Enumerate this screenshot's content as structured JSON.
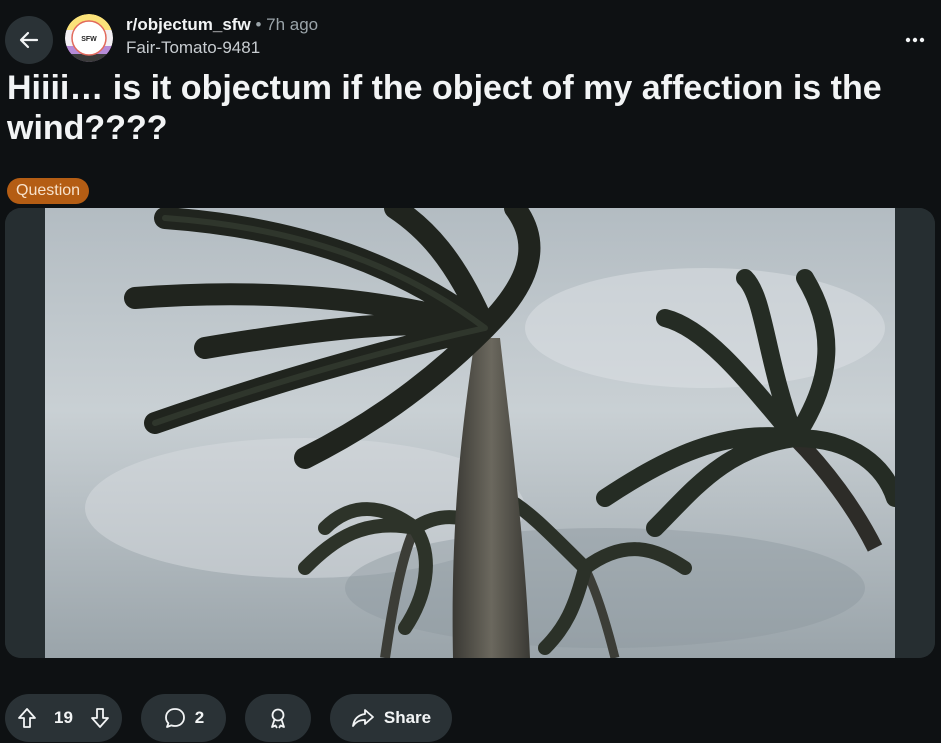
{
  "post": {
    "subreddit": "r/objectum_sfw",
    "separator": "•",
    "time_ago": "7h ago",
    "author": "Fair-Tomato-9481",
    "avatar_text": "SFW",
    "title": "Hiiii… is it objectum if the object of my affection is the wind????",
    "flair": "Question"
  },
  "actions": {
    "vote_count": "19",
    "comment_count": "2",
    "share_label": "Share"
  },
  "icons": {
    "back": "arrow-left-icon",
    "more": "more-horizontal-icon",
    "upvote": "arrow-up-icon",
    "downvote": "arrow-down-icon",
    "comment": "speech-bubble-icon",
    "award": "award-ribbon-icon",
    "share": "share-arrow-icon"
  },
  "colors": {
    "background": "#0e1113",
    "button": "#2a3236",
    "flair": "#b45d14"
  }
}
